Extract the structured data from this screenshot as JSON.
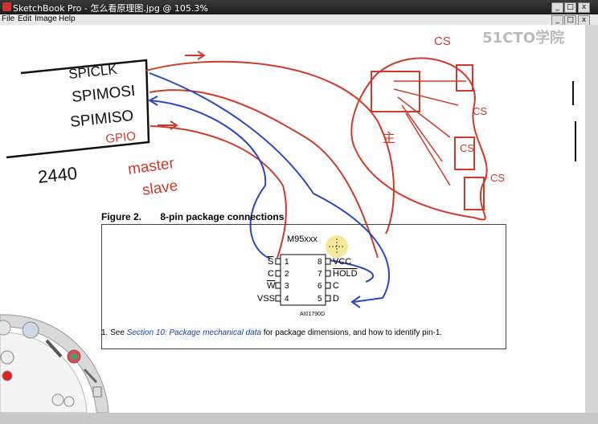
{
  "window": {
    "title": "SketchBook Pro - 怎么看原理图.jpg @ 105.3%",
    "minimize": "_",
    "maximize": "□",
    "close": "x"
  },
  "menu": [
    "File",
    "Edit",
    "Image",
    "Help"
  ],
  "watermark": "51CTO学院",
  "sketch": {
    "labels": [
      "SPICLK",
      "SPIMOSI",
      "SPIMISO",
      "GPIO",
      "2440",
      "master",
      "slave",
      "CS",
      "CS",
      "CS",
      "CS",
      "主"
    ]
  },
  "figure": {
    "number": "Figure 2.",
    "caption": "8-pin package connections",
    "chip": "M95xxx",
    "left_pins": [
      {
        "name": "S",
        "num": "1"
      },
      {
        "name": "C",
        "num": "2"
      },
      {
        "name": "W",
        "num": "3"
      },
      {
        "name": "VSS",
        "num": "4"
      }
    ],
    "right_pins": [
      {
        "name": "VCC",
        "num": "8"
      },
      {
        "name": "HOLD",
        "num": "7"
      },
      {
        "name": "C",
        "num": "6"
      },
      {
        "name": "D",
        "num": "5"
      }
    ],
    "ref": "AI01790D"
  },
  "footnote": {
    "prefix": "1.   See ",
    "link": "Section 10: Package mechanical data",
    "suffix": " for package dimensions, and how to identify pin-1."
  }
}
